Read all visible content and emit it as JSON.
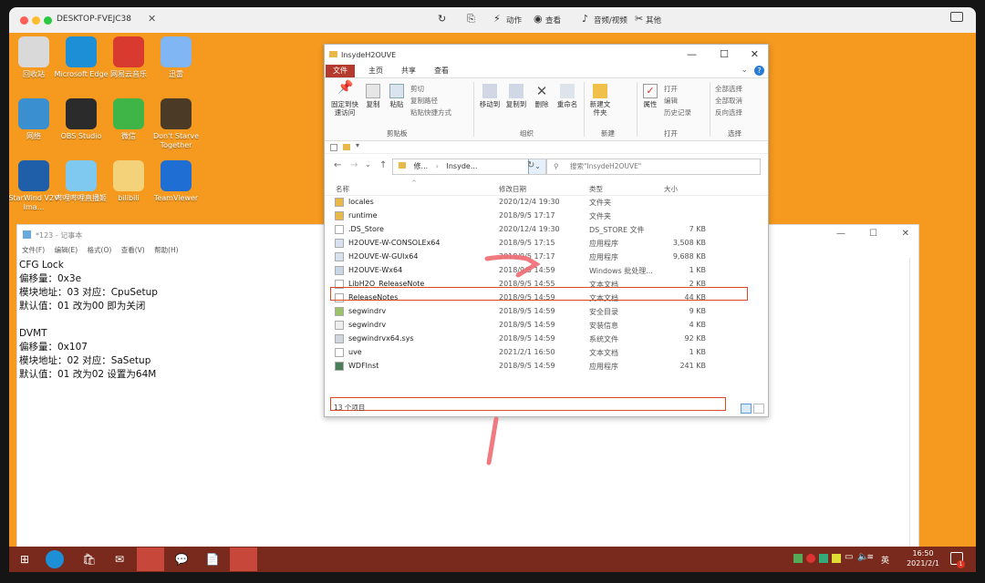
{
  "viewer": {
    "title": "DESKTOP-FVEJC38",
    "actions_label": "动作",
    "view_label": "查看",
    "av_label": "音频/视频",
    "other_label": "其他"
  },
  "desktop_icons": [
    {
      "label": "回收站",
      "color": "#d9d9d9",
      "icon": "recycle-bin-icon"
    },
    {
      "label": "Microsoft Edge",
      "color": "#1d8fd6",
      "icon": "edge-icon"
    },
    {
      "label": "网易云音乐",
      "color": "#d93a30",
      "icon": "netease-music-icon"
    },
    {
      "label": "迅雷",
      "color": "#7fb6f3",
      "icon": "xunlei-icon"
    },
    {
      "label": "网络",
      "color": "#3a8fd0",
      "icon": "network-icon"
    },
    {
      "label": "OBS Studio",
      "color": "#2b2b2b",
      "icon": "obs-icon"
    },
    {
      "label": "微信",
      "color": "#3fb547",
      "icon": "wechat-icon"
    },
    {
      "label": "Don't Starve Together",
      "color": "#4a3a26",
      "icon": "dont-starve-icon"
    },
    {
      "label": "StarWind V2V Ima...",
      "color": "#1f5ea8",
      "icon": "starwind-icon"
    },
    {
      "label": "哔哩哔哩直播姬",
      "color": "#7fc8ef",
      "icon": "bilibili-live-icon"
    },
    {
      "label": "bilibili",
      "color": "#f3d27a",
      "icon": "bilibili-folder-icon"
    },
    {
      "label": "TeamViewer",
      "color": "#1f6ed4",
      "icon": "teamviewer-icon"
    }
  ],
  "notepad": {
    "title": "*123 - 记事本",
    "menu": [
      "文件(F)",
      "编辑(E)",
      "格式(O)",
      "查看(V)",
      "帮助(H)"
    ],
    "lines": [
      "CFG Lock",
      "偏移量：0x3e",
      "模块地址：03 对应：CpuSetup",
      "默认值：01   改为00 即为关闭",
      "",
      "DVMT",
      "偏移量：0x107",
      "模块地址：02 对应：SaSetup",
      "默认值：01   改为02 设置为64M"
    ]
  },
  "explorer": {
    "title": "InsydeH2OUVE",
    "tabs": [
      "文件",
      "主页",
      "共享",
      "查看"
    ],
    "ribbon": {
      "pin": "固定到快速访问",
      "copy": "复制",
      "paste": "粘贴",
      "cut": "剪切",
      "copy_path": "复制路径",
      "paste_shortcut": "粘贴快捷方式",
      "group_clipboard": "剪贴板",
      "move_to": "移动到",
      "copy_to": "复制到",
      "delete": "删除",
      "rename": "重命名",
      "group_organize": "组织",
      "new_folder": "新建文件夹",
      "group_new": "新建",
      "properties": "属性",
      "open": "打开",
      "edit": "编辑",
      "history": "历史记录",
      "group_open": "打开",
      "select_all": "全部选择",
      "select_none": "全部取消",
      "invert": "反向选择",
      "group_select": "选择"
    },
    "address": [
      "修...",
      "Insyde..."
    ],
    "search_placeholder": "搜索\"InsydeH2OUVE\"",
    "columns": {
      "name": "名称",
      "date": "修改日期",
      "type": "类型",
      "size": "大小"
    },
    "files": [
      {
        "name": "locales",
        "date": "2020/12/4 19:30",
        "type": "文件夹",
        "size": "",
        "kind": "folder"
      },
      {
        "name": "runtime",
        "date": "2018/9/5 17:17",
        "type": "文件夹",
        "size": "",
        "kind": "folder"
      },
      {
        "name": ".DS_Store",
        "date": "2020/12/4 19:30",
        "type": "DS_STORE 文件",
        "size": "7 KB",
        "kind": "file"
      },
      {
        "name": "H2OUVE-W-CONSOLEx64",
        "date": "2018/9/5 17:15",
        "type": "应用程序",
        "size": "3,508 KB",
        "kind": "app"
      },
      {
        "name": "H2OUVE-W-GUIx64",
        "date": "2018/9/5 17:17",
        "type": "应用程序",
        "size": "9,688 KB",
        "kind": "app"
      },
      {
        "name": "H2OUVE-Wx64",
        "date": "2018/9/5 14:59",
        "type": "Windows 批处理...",
        "size": "1 KB",
        "kind": "bat"
      },
      {
        "name": "LibH2O_ReleaseNote",
        "date": "2018/9/5 14:55",
        "type": "文本文档",
        "size": "2 KB",
        "kind": "text"
      },
      {
        "name": "ReleaseNotes",
        "date": "2018/9/5 14:59",
        "type": "文本文档",
        "size": "44 KB",
        "kind": "text"
      },
      {
        "name": "segwindrv",
        "date": "2018/9/5 14:59",
        "type": "安全目录",
        "size": "9 KB",
        "kind": "cat"
      },
      {
        "name": "segwindrv",
        "date": "2018/9/5 14:59",
        "type": "安装信息",
        "size": "4 KB",
        "kind": "inf"
      },
      {
        "name": "segwindrvx64.sys",
        "date": "2018/9/5 14:59",
        "type": "系统文件",
        "size": "92 KB",
        "kind": "sys"
      },
      {
        "name": "uve",
        "date": "2021/2/1 16:50",
        "type": "文本文档",
        "size": "1 KB",
        "kind": "text"
      },
      {
        "name": "WDFInst",
        "date": "2018/9/5 14:59",
        "type": "应用程序",
        "size": "241 KB",
        "kind": "app2"
      }
    ],
    "status": "13 个项目"
  },
  "taskbar": {
    "time": "16:50",
    "date": "2021/2/1",
    "lang": "英",
    "badge": "1"
  },
  "colors": {
    "desktop": "#f59a1e",
    "taskbar": "#7a2a1c",
    "highlight": "#d84a24",
    "file_tab": "#b33a2c"
  }
}
